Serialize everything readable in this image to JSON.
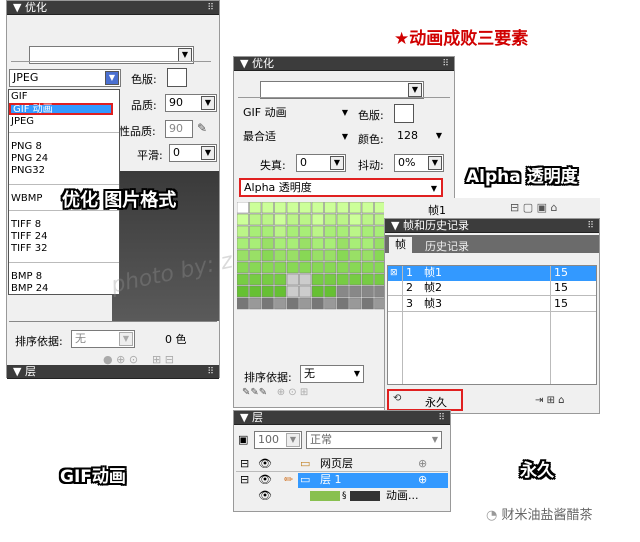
{
  "captions": {
    "top_right": "★动画成败三要素",
    "format": "优化 图片格式",
    "alpha": "Alpha 透明度",
    "gif": "GIF动画",
    "forever": "永久",
    "watermark_logo": "财米油盐酱醋茶",
    "watermark_diag": "photo by: zhu"
  },
  "left_panel": {
    "title": "优化",
    "format_select": "JPEG",
    "color_label": "色版:",
    "quality_label": "品质:",
    "quality_value": "90",
    "sel_quality_label": "性品质:",
    "sel_quality_value": "90",
    "smooth_label": "平滑:",
    "smooth_value": "0",
    "format_options": [
      "GIF",
      "GIF 动画",
      "JPEG",
      "PNG 8",
      "PNG 24",
      "PNG32",
      "WBMP",
      "TIFF 8",
      "TIFF 24",
      "TIFF 32",
      "BMP 8",
      "BMP 24"
    ],
    "sort_label": "排序依据:",
    "sort_value": "无",
    "color_count": "0 色",
    "layers_title": "层"
  },
  "mid_panel": {
    "title": "优化",
    "format_select": "GIF 动画",
    "color_label": "色版:",
    "palette_select": "最合适",
    "colors_label": "颜色:",
    "colors_value": "128",
    "loss_label": "失真:",
    "loss_value": "0",
    "dither_label": "抖动:",
    "dither_value": "0%",
    "alpha_select": "Alpha 透明度",
    "sort_label": "排序依据:",
    "sort_value": "无"
  },
  "frames_panel": {
    "top_label": "帧1",
    "title": "帧和历史记录",
    "tabs": [
      "帧",
      "历史记录"
    ],
    "frames": [
      {
        "num": "1",
        "name": "帧1",
        "delay": "15"
      },
      {
        "num": "2",
        "name": "帧2",
        "delay": "15"
      },
      {
        "num": "3",
        "name": "帧3",
        "delay": "15"
      }
    ],
    "loop_label": "永久"
  },
  "layers_panel": {
    "title": "层",
    "opacity": "100",
    "blend": "正常",
    "rows": [
      {
        "name": "网页层"
      },
      {
        "name": "层 1"
      },
      {
        "name": "动画..."
      }
    ]
  },
  "colors": {
    "panel_title_bg": "#3c3c3c",
    "highlight": "#3399ff",
    "red_box": "#e02020",
    "caption_red": "#d00000",
    "swatch_light": "#ccff99",
    "swatch_mid": "#66cc33"
  }
}
